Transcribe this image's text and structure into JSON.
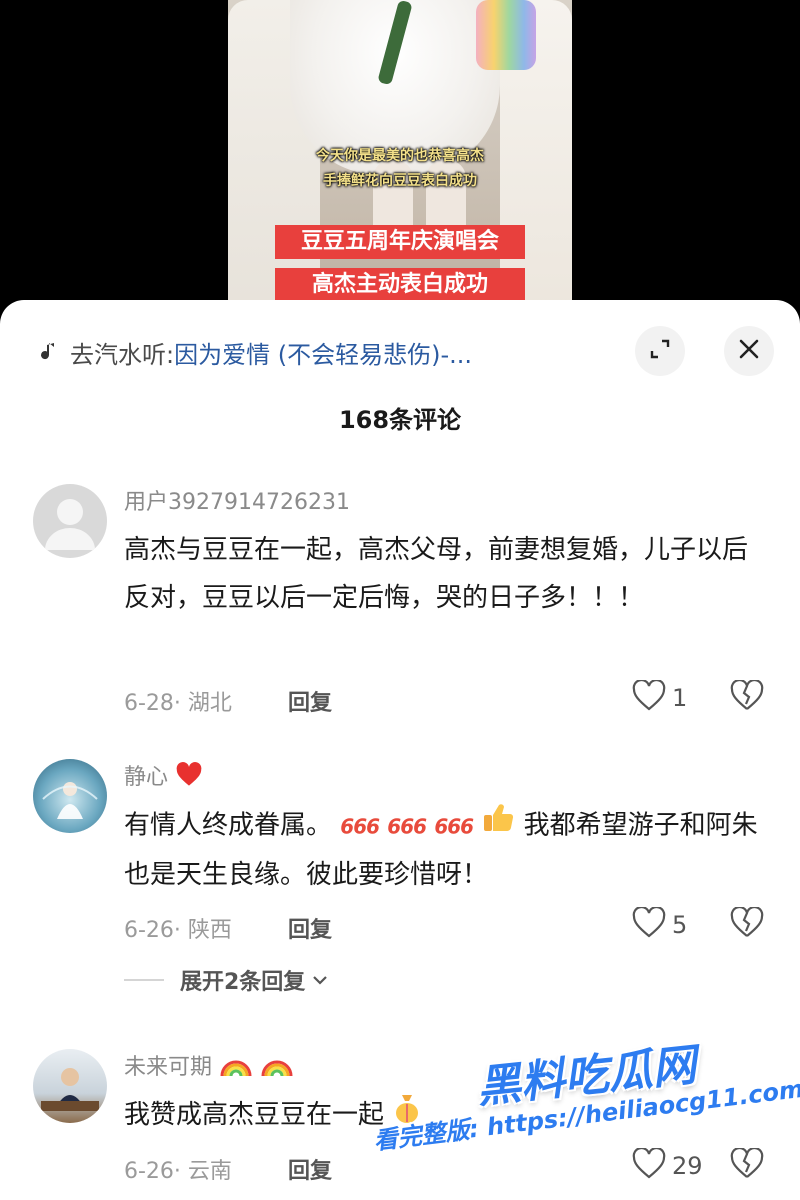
{
  "video": {
    "subtitle_line1": "今天你是最美的也恭喜高杰",
    "subtitle_line2": "手捧鲜花向豆豆表白成功",
    "banner_line1": "豆豆五周年庆演唱会",
    "banner_line2": "高杰主动表白成功"
  },
  "header": {
    "music_prefix": "去汽水听:",
    "music_title": "因为爱情 (不会轻易悲伤)-...",
    "music_icon": "music-note-icon",
    "expand_icon": "expand-icon",
    "close_icon": "close-icon"
  },
  "comment_count": "168条评论",
  "comments": [
    {
      "username": "用户3927914726231",
      "avatar": "default-user-avatar",
      "text": "高杰与豆豆在一起，高杰父母，前妻想复婚，儿子以后反对，豆豆以后一定后悔，哭的日子多！！！",
      "date_location": "6-28· 湖北",
      "reply_label": "回复",
      "likes": "1"
    },
    {
      "username": "静心",
      "username_emoji": "red-heart",
      "avatar": "meditation-avatar",
      "text_part1": "有情人终成眷属。",
      "num666": "666",
      "text_part2": "我都希望游子和阿朱也是天生良缘。彼此要珍惜呀！",
      "date_location": "6-26· 陕西",
      "reply_label": "回复",
      "likes": "5",
      "expand_replies": "展开2条回复"
    },
    {
      "username": "未来可期",
      "username_emoji": "rainbow",
      "avatar": "man-at-desk-avatar",
      "text": "我赞成高杰豆豆在一起",
      "date_location": "6-26· 云南",
      "reply_label": "回复",
      "likes": "29"
    }
  ],
  "watermark": {
    "logo": "黑料吃瓜网",
    "url_line": "看完整版: https://heiliaocg11.com"
  },
  "colors": {
    "banner_red": "#e8403d",
    "subtitle_yellow": "#f3e08a",
    "music_title_blue": "#2b5aa0",
    "watermark_blue": "#2d7cf0"
  }
}
